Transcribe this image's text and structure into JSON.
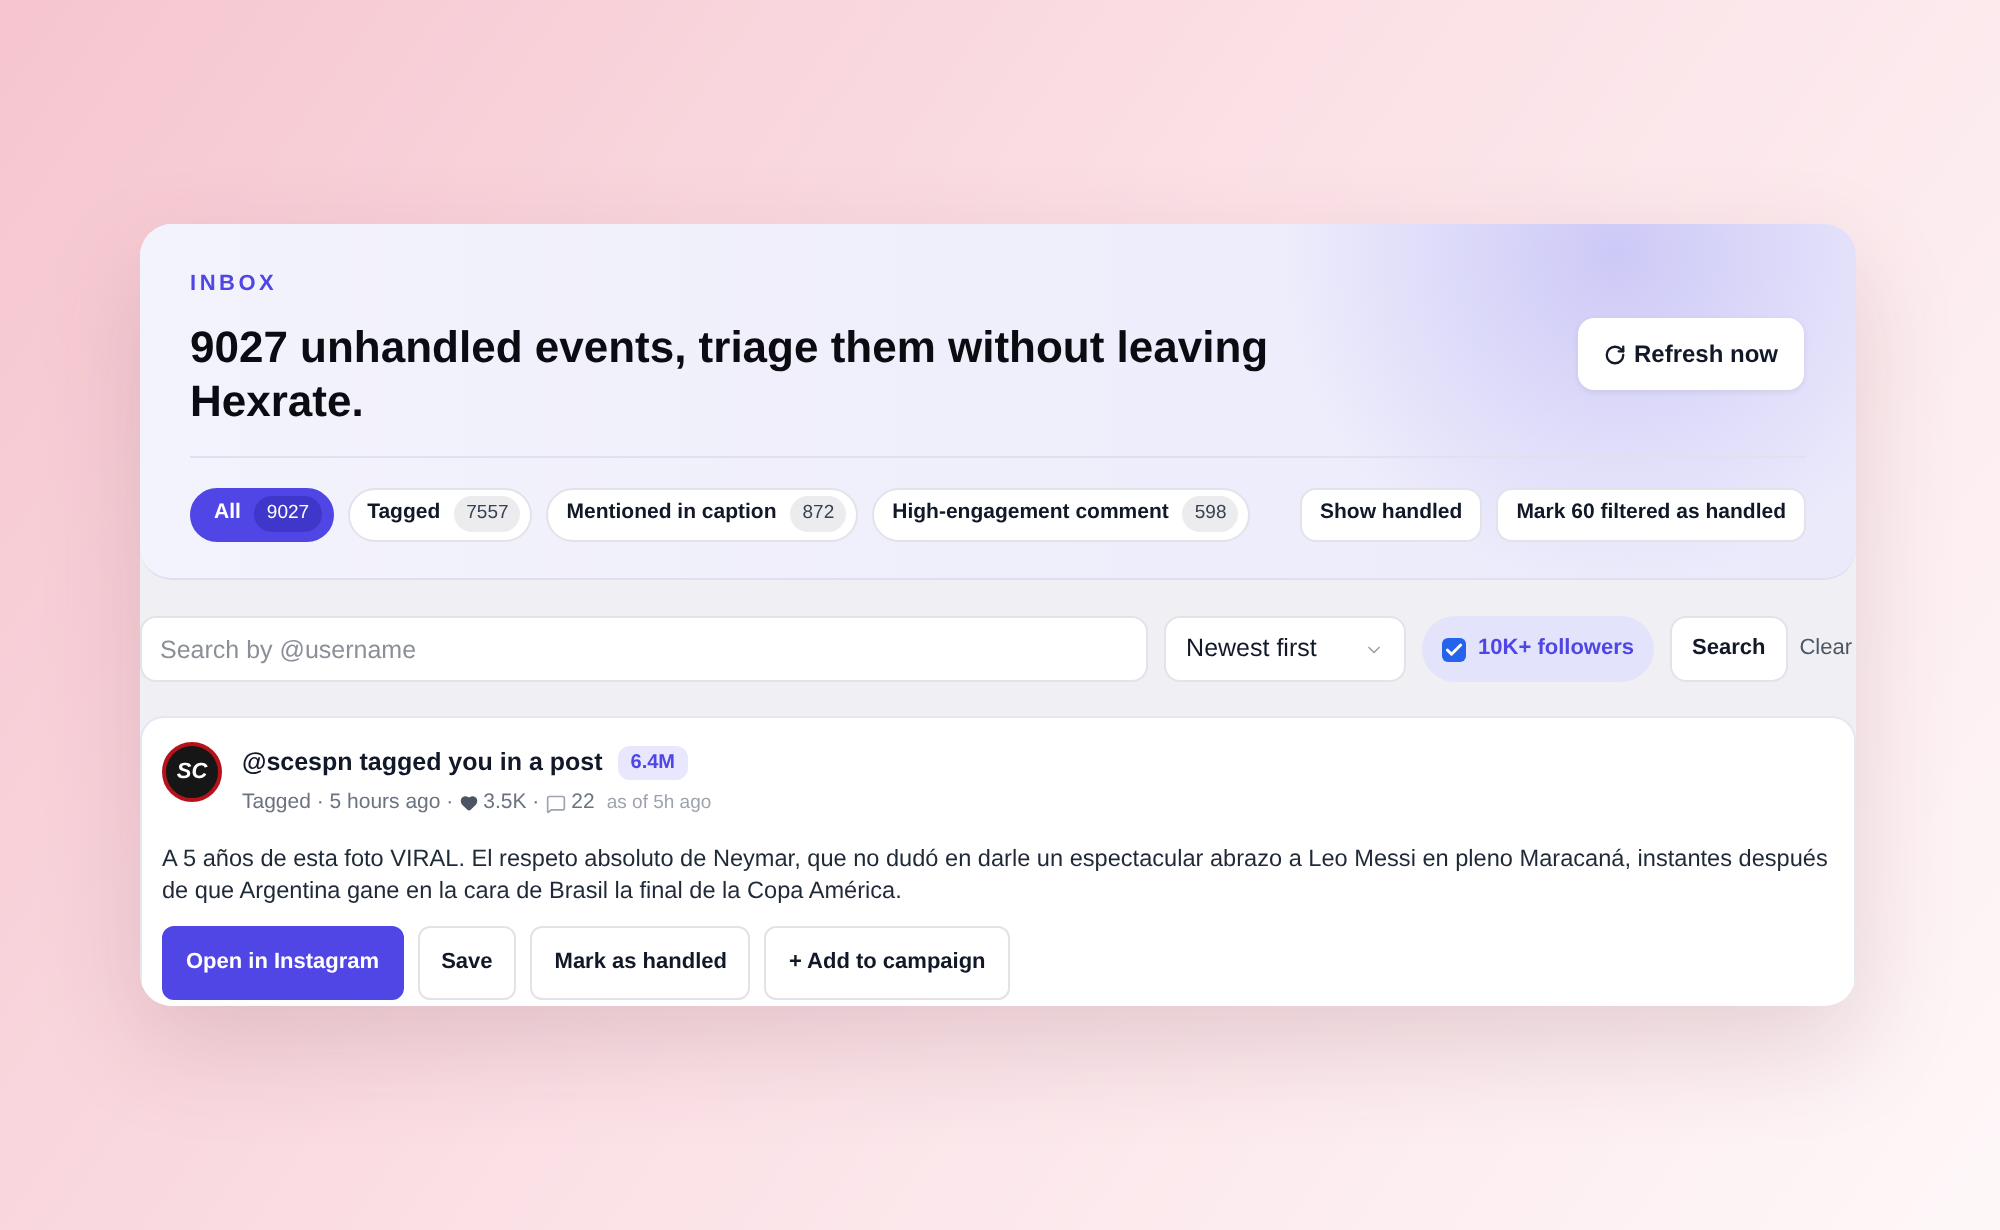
{
  "header": {
    "eyebrow": "INBOX",
    "title": "9027 unhandled events, triage them without leaving Hexrate.",
    "refresh_button": "Refresh now"
  },
  "filters": [
    {
      "label": "All",
      "count": "9027",
      "selected": true
    },
    {
      "label": "Tagged",
      "count": "7557",
      "selected": false
    },
    {
      "label": "Mentioned in caption",
      "count": "872",
      "selected": false
    },
    {
      "label": "High-engagement comment",
      "count": "598",
      "selected": false
    }
  ],
  "bulk_actions": [
    "Show handled",
    "Mark 60 filtered as handled"
  ],
  "search": {
    "placeholder": "Search by @username",
    "sort": "Newest first",
    "followers_filter": {
      "label": "10K+ followers",
      "checked": true
    },
    "search_button": "Search",
    "clear_button": "Clear"
  },
  "events": [
    {
      "avatar": "SC",
      "title": "@scespn tagged you in a post",
      "reach": "6.4M",
      "type": "Tagged",
      "separator": "·",
      "time": "5 hours ago",
      "likes": "3.5K",
      "comments": "22",
      "as_of": "as of 5h ago",
      "text": "A 5 años de esta foto VIRAL. El respeto absoluto de Neymar, que no dudó en darle un espectacular abrazo a Leo Messi en pleno Maracaná, instantes después de que Argentina gane en la cara de Brasil la final de la Copa América.",
      "actions": [
        {
          "label": "Open in Instagram",
          "kind": "primary"
        },
        {
          "label": "Save",
          "kind": "secondary"
        },
        {
          "label": "Mark as handled",
          "kind": "secondary"
        },
        {
          "label": "+ Add to campaign",
          "kind": "secondary"
        }
      ]
    }
  ]
}
